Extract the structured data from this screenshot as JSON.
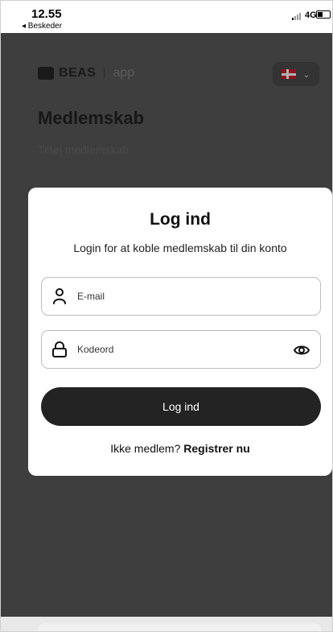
{
  "status_bar": {
    "time": "12.55",
    "back_label": "◂ Beskeder",
    "network": "4G"
  },
  "header": {
    "logo_text": "BEAS",
    "logo_app": "app",
    "language_chevron": "⌄"
  },
  "page": {
    "title": "Medlemskab",
    "subtitle": "Tilføj medlemskab"
  },
  "login_modal": {
    "title": "Log ind",
    "subtitle": "Login for at koble medlemskab til din konto",
    "email_placeholder": "E-mail",
    "password_placeholder": "Kodeord",
    "login_button": "Log ind",
    "register_prefix": "Ikke medlem? ",
    "register_link": "Registrer nu"
  },
  "icons": {
    "email": "user-icon",
    "password": "lock-icon",
    "show_password": "eye-icon"
  },
  "colors": {
    "primary_button": "#232323",
    "overlay": "#3e3e3e",
    "flag_red": "#8a1420"
  }
}
